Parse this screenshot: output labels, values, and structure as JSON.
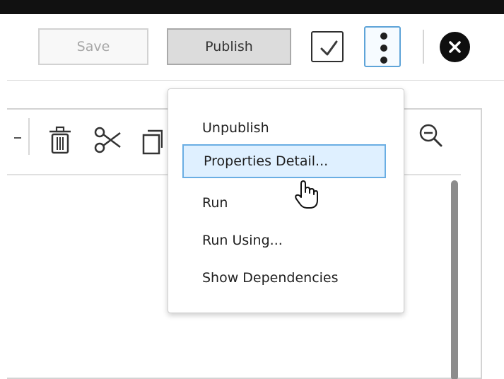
{
  "header": {
    "save_label": "Save",
    "publish_label": "Publish"
  },
  "icons": {
    "checkbox": "checkbox-icon",
    "more": "more-vertical-icon",
    "close": "close-icon",
    "delete": "trash-icon",
    "cut": "scissors-icon",
    "copy": "copy-icon",
    "zoom_out": "zoom-out-icon",
    "cursor": "hand-pointer-icon"
  },
  "menu": {
    "items": [
      {
        "label": "Unpublish"
      },
      {
        "label": "Properties Detail..."
      },
      {
        "label": "Run"
      },
      {
        "label": "Run Using..."
      },
      {
        "label": "Show Dependencies"
      }
    ]
  },
  "colors": {
    "accent": "#5ea4d8",
    "highlight": "#dff0ff"
  }
}
